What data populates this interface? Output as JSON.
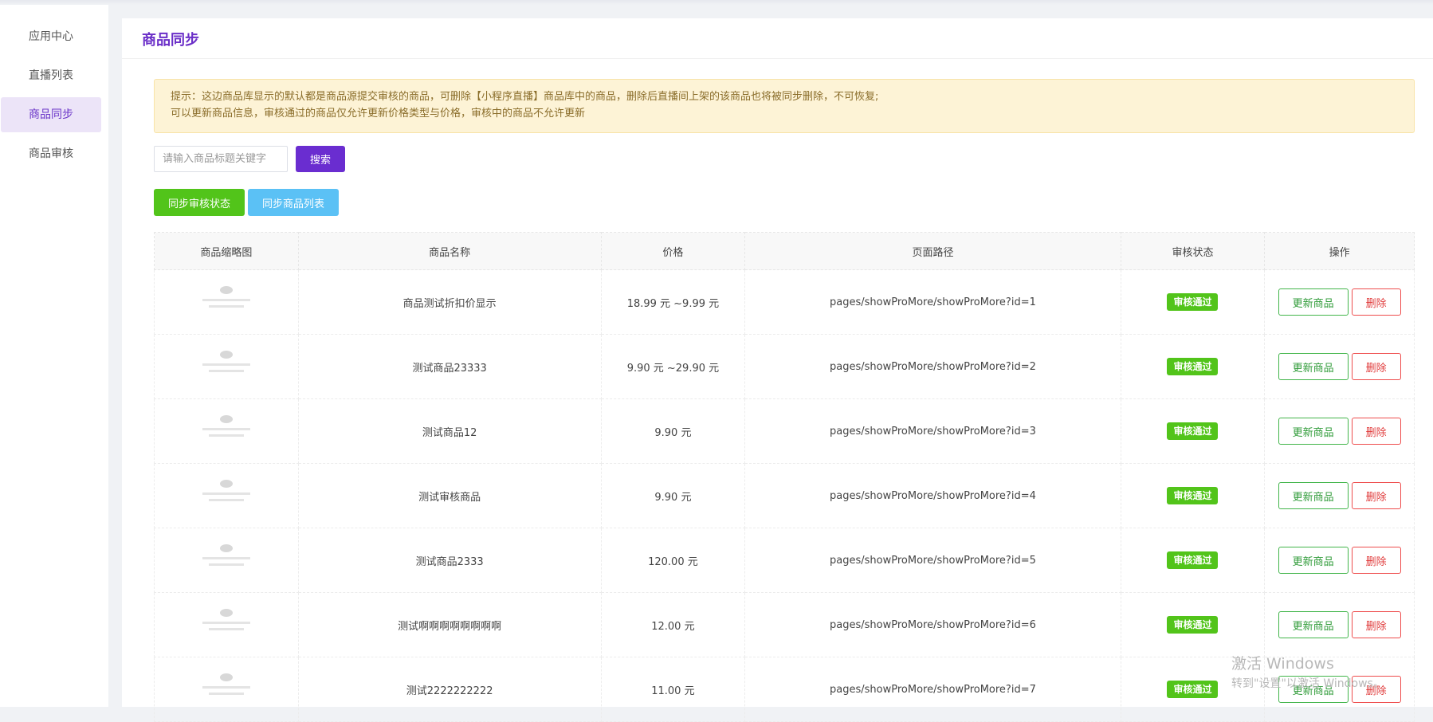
{
  "sidebar": {
    "items": [
      {
        "label": "应用中心"
      },
      {
        "label": "直播列表"
      },
      {
        "label": "商品同步"
      },
      {
        "label": "商品审核"
      }
    ]
  },
  "page": {
    "title": "商品同步"
  },
  "tip": {
    "line1": "提示：这边商品库显示的默认都是商品源提交审核的商品，可删除【小程序直播】商品库中的商品，删除后直播间上架的该商品也将被同步删除，不可恢复;",
    "line2": "可以更新商品信息，审核通过的商品仅允许更新价格类型与价格，审核中的商品不允许更新"
  },
  "search": {
    "placeholder": "请输入商品标题关键字",
    "button": "搜索"
  },
  "actions": {
    "sync_status": "同步审核状态",
    "sync_list": "同步商品列表"
  },
  "table": {
    "headers": [
      "商品缩略图",
      "商品名称",
      "价格",
      "页面路径",
      "审核状态",
      "操作"
    ],
    "rows": [
      {
        "name": "商品测试折扣价显示",
        "price": "18.99 元 ~9.99 元",
        "path": "pages/showProMore/showProMore?id=1",
        "status": "审核通过",
        "update": "更新商品",
        "delete": "删除"
      },
      {
        "name": "测试商品23333",
        "price": "9.90 元 ~29.90 元",
        "path": "pages/showProMore/showProMore?id=2",
        "status": "审核通过",
        "update": "更新商品",
        "delete": "删除"
      },
      {
        "name": "测试商品12",
        "price": "9.90 元",
        "path": "pages/showProMore/showProMore?id=3",
        "status": "审核通过",
        "update": "更新商品",
        "delete": "删除"
      },
      {
        "name": "测试审核商品",
        "price": "9.90 元",
        "path": "pages/showProMore/showProMore?id=4",
        "status": "审核通过",
        "update": "更新商品",
        "delete": "删除"
      },
      {
        "name": "测试商品2333",
        "price": "120.00 元",
        "path": "pages/showProMore/showProMore?id=5",
        "status": "审核通过",
        "update": "更新商品",
        "delete": "删除"
      },
      {
        "name": "测试啊啊啊啊啊啊啊啊",
        "price": "12.00 元",
        "path": "pages/showProMore/showProMore?id=6",
        "status": "审核通过",
        "update": "更新商品",
        "delete": "删除"
      },
      {
        "name": "测试2222222222",
        "price": "11.00 元",
        "path": "pages/showProMore/showProMore?id=7",
        "status": "审核通过",
        "update": "更新商品",
        "delete": "删除"
      }
    ]
  },
  "watermark": {
    "line1": "激活 Windows",
    "line2": "转到\"设置\"以激活 Windows。"
  },
  "colors": {
    "accent": "#6a2dd0",
    "success": "#52c41a",
    "info": "#5bc1f5",
    "danger": "#ee4d4d",
    "tip_bg": "#fdf3d6"
  }
}
